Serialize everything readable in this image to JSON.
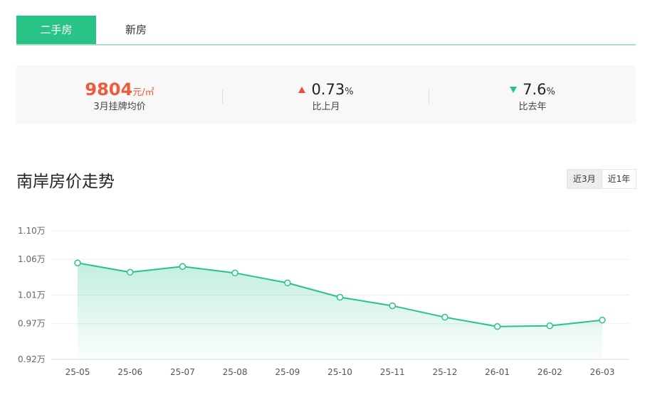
{
  "tabs": {
    "second_hand": "二手房",
    "new_house": "新房"
  },
  "stats": {
    "price_value": "9804",
    "price_unit": "元/㎡",
    "price_label": "3月挂牌均价",
    "mom_value": "0.73",
    "mom_pct": "%",
    "mom_label": "比上月",
    "yoy_value": "7.6",
    "yoy_pct": "%",
    "yoy_label": "比去年",
    "up_color": "#ef4b3c",
    "down_color": "#28c487"
  },
  "section_title": "南岸房价走势",
  "range": {
    "three_months": "近3月",
    "one_year": "近1年"
  },
  "chart_data": {
    "type": "area",
    "title": "",
    "xlabel": "",
    "ylabel": "",
    "categories": [
      "25-05",
      "25-06",
      "25-07",
      "25-08",
      "25-09",
      "25-10",
      "25-11",
      "25-12",
      "26-01",
      "26-02",
      "26-03"
    ],
    "series": [
      {
        "values": [
          1.055,
          1.042,
          1.05,
          1.041,
          1.027,
          1.007,
          0.995,
          0.979,
          0.966,
          0.967,
          0.975
        ]
      }
    ],
    "yticks": [
      "1.10万",
      "1.06万",
      "1.01万",
      "0.97万",
      "0.92万"
    ],
    "ytick_values": [
      1.1,
      1.06,
      1.01,
      0.97,
      0.92
    ],
    "ylim": [
      0.92,
      1.1
    ],
    "grid": true,
    "legend": "none",
    "line_color": "#28c487"
  }
}
